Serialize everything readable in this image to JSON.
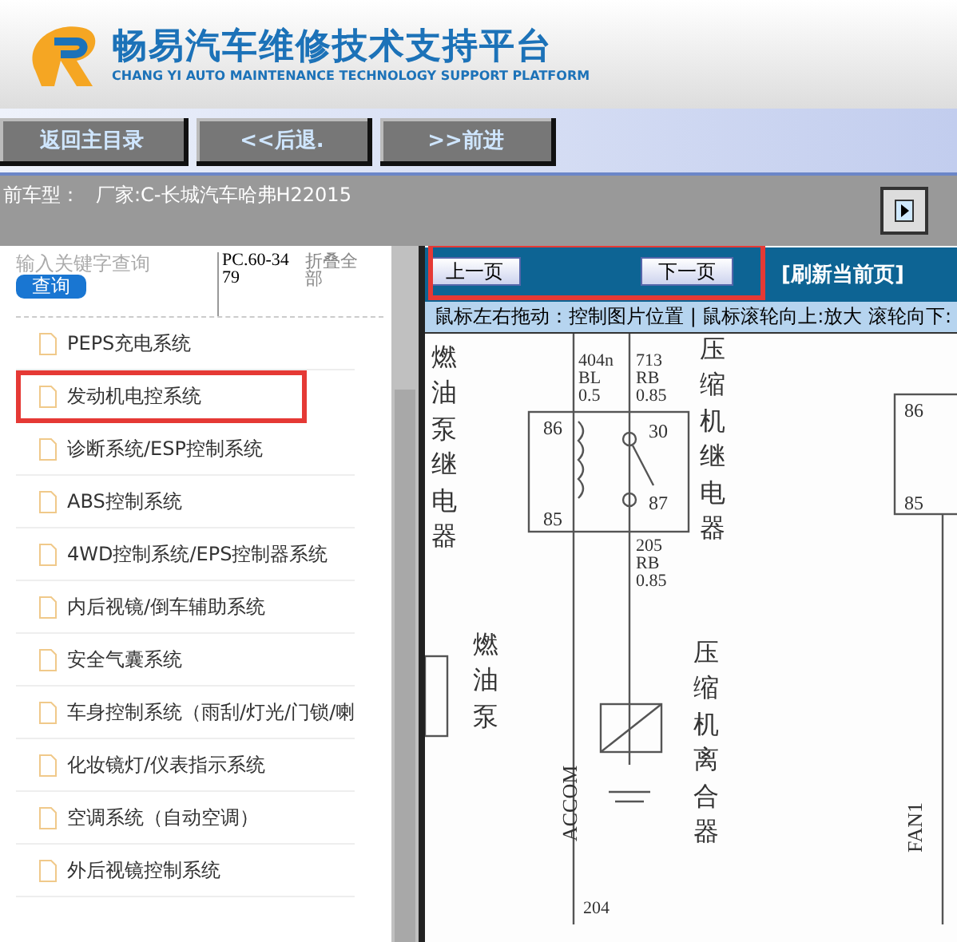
{
  "header": {
    "title": "畅易汽车维修技术支持平台",
    "subtitle": "CHANG YI AUTO MAINTENANCE TECHNOLOGY SUPPORT PLATFORM"
  },
  "nav_buttons": [
    "返回主目录",
    "<<后退.",
    ">>前进"
  ],
  "vehicle_bar": {
    "label": "前车型：",
    "value": "厂家:C-长城汽车哈弗H22015"
  },
  "sidebar": {
    "search": {
      "placeholder": "输入关键字查询",
      "button": "查询"
    },
    "code": "PC.60-3479",
    "collapse": "折叠全部",
    "items": [
      {
        "label": "PEPS充电系统",
        "highlighted": false
      },
      {
        "label": "发动机电控系统",
        "highlighted": true
      },
      {
        "label": "诊断系统/ESP控制系统",
        "highlighted": false
      },
      {
        "label": "ABS控制系统",
        "highlighted": false
      },
      {
        "label": "4WD控制系统/EPS控制器系统",
        "highlighted": false
      },
      {
        "label": "内后视镜/倒车辅助系统",
        "highlighted": false
      },
      {
        "label": "安全气囊系统",
        "highlighted": false
      },
      {
        "label": "车身控制系统（雨刮/灯光/门锁/喇",
        "highlighted": false
      },
      {
        "label": "化妆镜灯/仪表指示系统",
        "highlighted": false
      },
      {
        "label": "空调系统（自动空调）",
        "highlighted": false
      },
      {
        "label": "外后视镜控制系统",
        "highlighted": false
      }
    ]
  },
  "viewer": {
    "prev": "上一页",
    "next": "下一页",
    "refresh": "[刷新当前页]",
    "pager_highlighted": true,
    "hint": "鼠标左右拖动：控制图片位置 | 鼠标滚轮向上:放大  滚轮向下:",
    "diagram_labels": [
      {
        "text": "燃油泵继电器",
        "kind": "vertical"
      },
      {
        "text": "燃油泵",
        "kind": "vertical"
      },
      {
        "text": "404n\nBL\n0.5",
        "kind": "wire"
      },
      {
        "text": "713\nRB\n0.85",
        "kind": "wire"
      },
      {
        "text": "86",
        "kind": "pin"
      },
      {
        "text": "85",
        "kind": "pin"
      },
      {
        "text": "30",
        "kind": "pin"
      },
      {
        "text": "87",
        "kind": "pin"
      },
      {
        "text": "205\nRB\n0.85",
        "kind": "wire"
      },
      {
        "text": "压缩机继电器",
        "kind": "vertical"
      },
      {
        "text": "压缩机离合器",
        "kind": "vertical"
      },
      {
        "text": "ACCOM",
        "kind": "rotated"
      },
      {
        "text": "204",
        "kind": "wire"
      },
      {
        "text": "86",
        "kind": "pin"
      },
      {
        "text": "85",
        "kind": "pin"
      },
      {
        "text": "FAN1",
        "kind": "rotated"
      }
    ]
  }
}
